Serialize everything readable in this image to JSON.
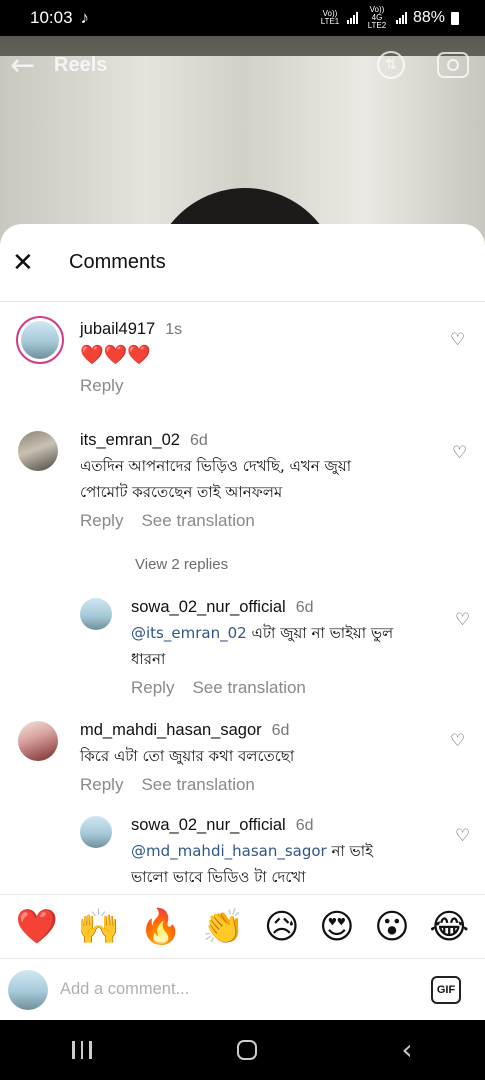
{
  "status": {
    "time": "10:03",
    "sim1": "Vo)) LTE1",
    "sim2": "Vo)) 4G LTE2",
    "battery": "88%"
  },
  "reels": {
    "title": "Reels",
    "back_icon": "arrow-left-icon",
    "upload_icon": "upload-icon",
    "camera_icon": "camera-icon"
  },
  "sheet": {
    "title": "Comments",
    "close_icon": "close-icon"
  },
  "comments": [
    {
      "username": "jubail4917",
      "time": "1s",
      "text": "❤️❤️❤️",
      "reply": "Reply"
    },
    {
      "username": "its_emran_02",
      "time": "6d",
      "text_line1": "এতদিন আপনাদের ভিড়িও দেখছি, এখন জুয়া",
      "text_line2": "পোমোট করতেছেন তাই আনফলম",
      "reply": "Reply",
      "translate": "See translation",
      "view_replies": "View 2 replies"
    },
    {
      "username": "sowa_02_nur_official",
      "time": "6d",
      "mention": "@its_emran_02",
      "text_line1": " এটা জুয়া না ভাইয়া ভুল",
      "text_line2": "ধারনা",
      "reply": "Reply",
      "translate": "See translation"
    },
    {
      "username": "md_mahdi_hasan_sagor",
      "time": "6d",
      "text_line1": "কিরে এটা তো জুয়ার কথা বলতেছো",
      "reply": "Reply",
      "translate": "See translation"
    },
    {
      "username": "sowa_02_nur_official",
      "time": "6d",
      "mention": "@md_mahdi_hasan_sagor",
      "text_line1": " না ভাই",
      "text_line2": "ভালো ভাবে ভিডিও টা দেখো"
    }
  ],
  "emojis": [
    "❤️",
    "🙌",
    "🔥",
    "👏",
    "😥",
    "😍",
    "😮",
    "😂"
  ],
  "input": {
    "placeholder": "Add a comment...",
    "gif_label": "GIF"
  }
}
